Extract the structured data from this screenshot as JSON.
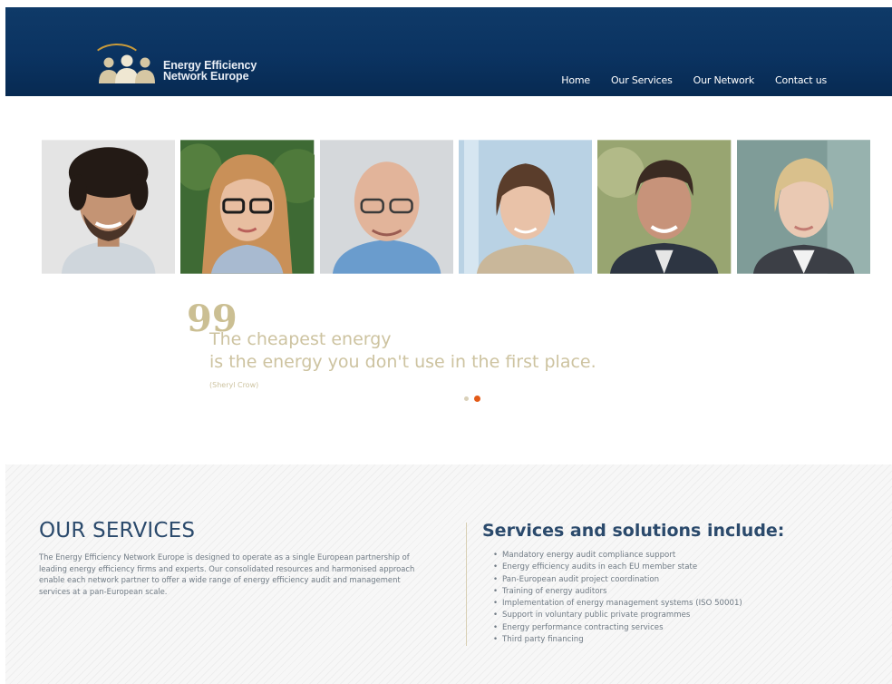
{
  "brand": {
    "line1": "Energy Efficiency",
    "line2": "Network Europe",
    "logo_icon": "people-group-icon",
    "gold": "#c99a3a"
  },
  "nav": {
    "items": [
      "Home",
      "Our Services",
      "Our Network",
      "Contact us"
    ]
  },
  "colors": {
    "header": "#0b3361",
    "quote": "#cdc3a0",
    "accent": "#e35a17",
    "heading": "#2b4a6c"
  },
  "quote": {
    "mark": "99",
    "line1": "The cheapest energy",
    "line2": "is the energy you don't use in the first place.",
    "author": "(Sheryl Crow)"
  },
  "carousel": {
    "count": 2,
    "active": 2
  },
  "services": {
    "title": "OUR SERVICES",
    "body": "The Energy Efficiency Network Europe is designed to operate as a single European partnership of leading energy efficiency firms and experts. Our consolidated resources and harmonised approach enable each network partner to offer a wide range of energy efficiency audit and management services at a pan-European scale."
  },
  "solutions": {
    "title": "Services and solutions include:",
    "items": [
      "Mandatory energy audit compliance support",
      "Energy efficiency audits in each EU member state",
      "Pan-European audit project coordination",
      "Training of energy auditors",
      "Implementation of energy management systems (ISO 50001)",
      "Support in voluntary public private programmes",
      "Energy performance contracting services",
      "Third party financing"
    ]
  }
}
